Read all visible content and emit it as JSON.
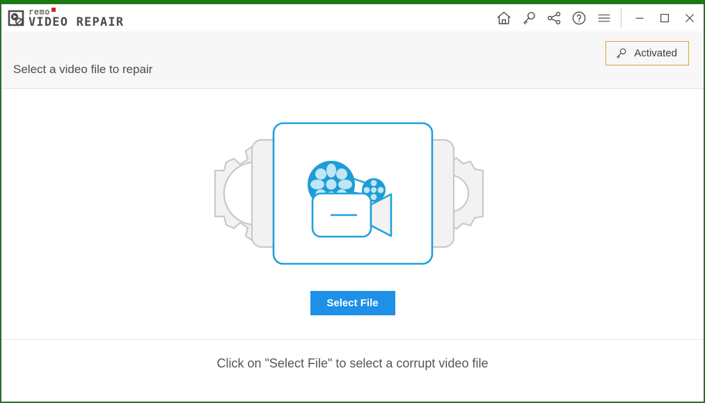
{
  "window": {
    "accent_green": "#1b7a14",
    "border_green": "#2b6b2b",
    "brand_remo": "remo",
    "brand_product": "VIDEO REPAIR",
    "brand_dot_color": "#d42222"
  },
  "titlebar": {
    "icons": [
      {
        "name": "home-icon",
        "label": "Home"
      },
      {
        "name": "key-icon",
        "label": "Activate"
      },
      {
        "name": "share-icon",
        "label": "Share"
      },
      {
        "name": "help-icon",
        "label": "Help"
      },
      {
        "name": "menu-icon",
        "label": "Menu"
      }
    ],
    "window_controls": [
      {
        "name": "minimize-button",
        "label": "Minimize"
      },
      {
        "name": "maximize-button",
        "label": "Maximize"
      },
      {
        "name": "close-button",
        "label": "Close"
      }
    ]
  },
  "header": {
    "title": "Select a video file to repair",
    "activated_label": "Activated",
    "activated_border_color": "#d9a238"
  },
  "main": {
    "illustration_name": "video-repair-illustration",
    "select_file_label": "Select File",
    "select_file_color": "#1e90e8",
    "illustration_colors": {
      "blue": "#1e9dd4",
      "blue_light": "#bfe6f5",
      "card_border": "#1e9dd4",
      "gear_fill": "#f2f2f2",
      "gear_stroke": "#c9c9c9"
    }
  },
  "footer": {
    "hint": "Click on \"Select File\" to select a corrupt video file"
  }
}
